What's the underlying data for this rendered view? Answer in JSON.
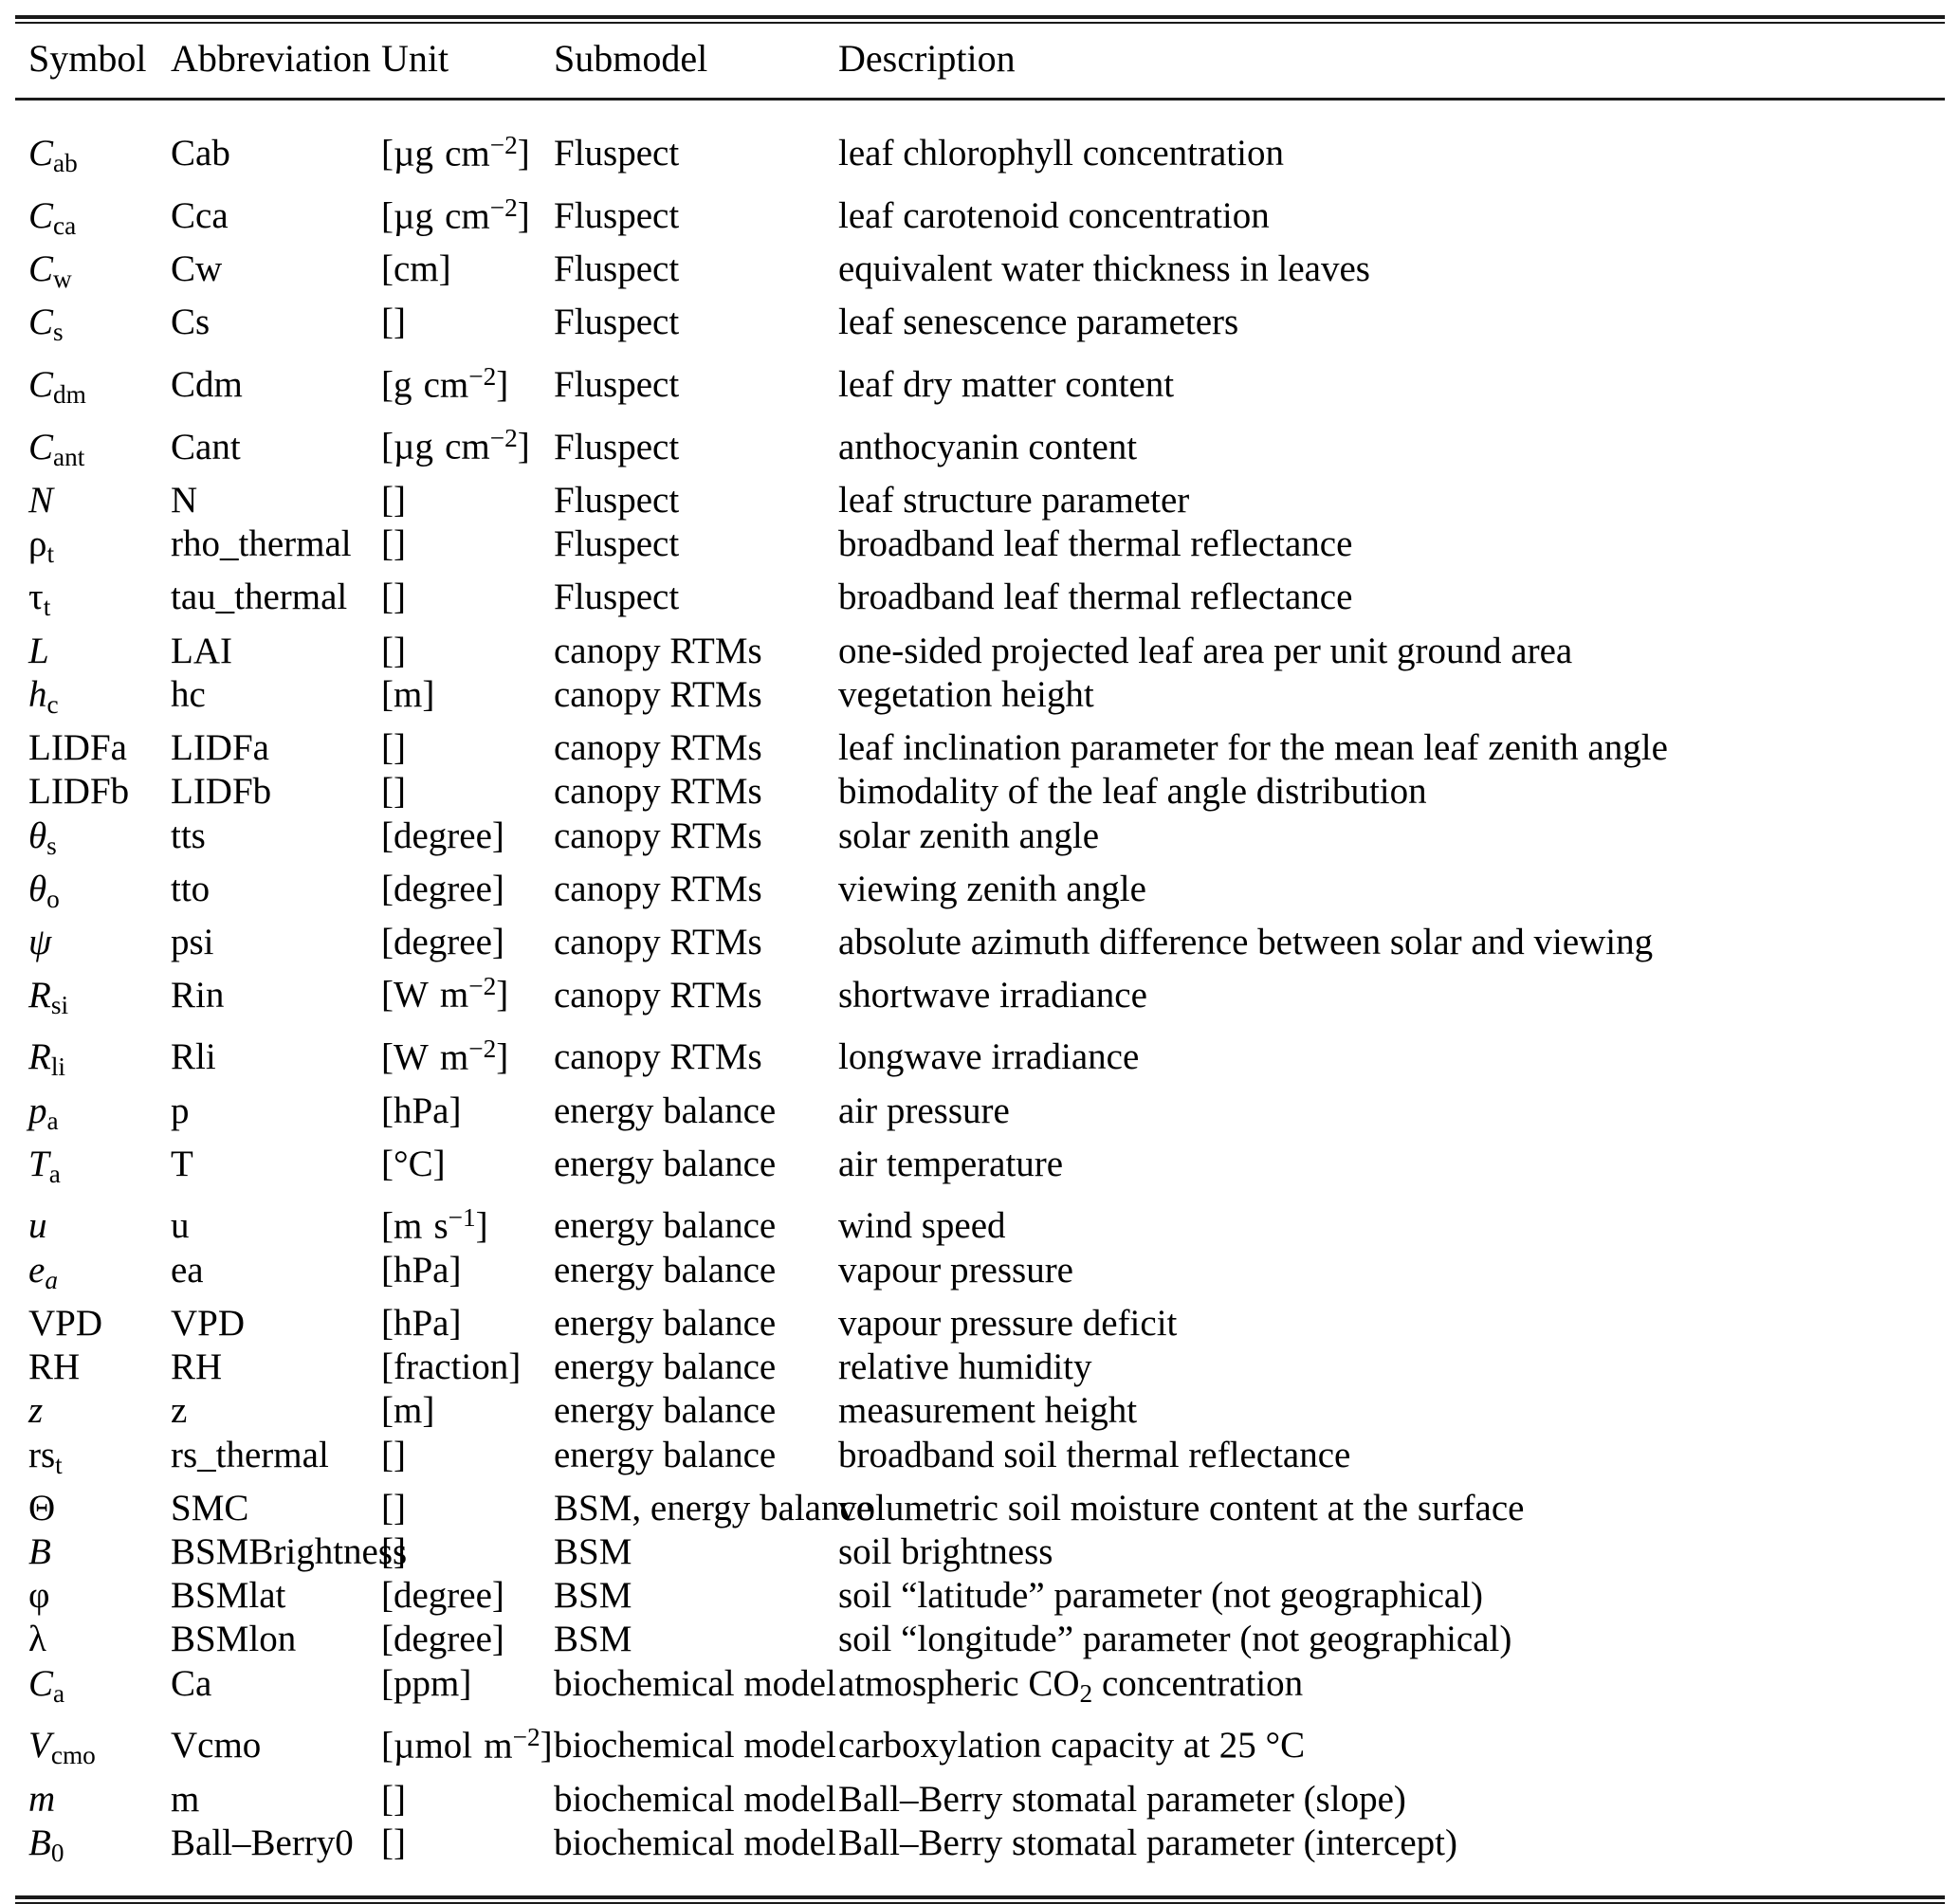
{
  "table": {
    "columns": [
      "Symbol",
      "Abbreviation",
      "Unit",
      "Submodel",
      "Description"
    ],
    "rows": [
      {
        "symbol": "C_ab",
        "symbol_text": "Cab",
        "abbreviation": "Cab",
        "unit": "[µg cm^-2]",
        "unit_text": "[µgcm−2]",
        "submodel": "Fluspect",
        "description": "leaf chlorophyll concentration"
      },
      {
        "symbol": "C_ca",
        "symbol_text": "Cca",
        "abbreviation": "Cca",
        "unit": "[µg cm^-2]",
        "unit_text": "[µgcm−2]",
        "submodel": "Fluspect",
        "description": "leaf carotenoid concentration"
      },
      {
        "symbol": "C_w",
        "symbol_text": "Cw",
        "abbreviation": "Cw",
        "unit": "[cm]",
        "unit_text": "[cm]",
        "submodel": "Fluspect",
        "description": "equivalent water thickness in leaves"
      },
      {
        "symbol": "C_s",
        "symbol_text": "Cs",
        "abbreviation": "Cs",
        "unit": "[]",
        "unit_text": "[]",
        "submodel": "Fluspect",
        "description": "leaf senescence parameters"
      },
      {
        "symbol": "C_dm",
        "symbol_text": "Cdm",
        "abbreviation": "Cdm",
        "unit": "[g cm^-2]",
        "unit_text": "[gcm−2]",
        "submodel": "Fluspect",
        "description": "leaf dry matter content"
      },
      {
        "symbol": "C_ant",
        "symbol_text": "Cant",
        "abbreviation": "Cant",
        "unit": "[µg cm^-2]",
        "unit_text": "[µgcm−2]",
        "submodel": "Fluspect",
        "description": "anthocyanin content"
      },
      {
        "symbol": "N",
        "symbol_text": "N",
        "abbreviation": "N",
        "unit": "[]",
        "unit_text": "[]",
        "submodel": "Fluspect",
        "description": "leaf structure parameter"
      },
      {
        "symbol": "rho_t",
        "symbol_text": "ρt",
        "abbreviation": "rho_thermal",
        "unit": "[]",
        "unit_text": "[]",
        "submodel": "Fluspect",
        "description": "broadband leaf thermal reflectance"
      },
      {
        "symbol": "tau_t",
        "symbol_text": "τt",
        "abbreviation": "tau_thermal",
        "unit": "[]",
        "unit_text": "[]",
        "submodel": "Fluspect",
        "description": "broadband leaf thermal reflectance"
      },
      {
        "symbol": "L",
        "symbol_text": "L",
        "abbreviation": "LAI",
        "unit": "[]",
        "unit_text": "[]",
        "submodel": "canopy RTMs",
        "description": "one-sided projected leaf area per unit ground area"
      },
      {
        "symbol": "h_c",
        "symbol_text": "hc",
        "abbreviation": "hc",
        "unit": "[m]",
        "unit_text": "[m]",
        "submodel": "canopy RTMs",
        "description": "vegetation height"
      },
      {
        "symbol": "LIDFa",
        "symbol_text": "LIDFa",
        "abbreviation": "LIDFa",
        "unit": "[]",
        "unit_text": "[]",
        "submodel": "canopy RTMs",
        "description": "leaf inclination parameter for the mean leaf zenith angle"
      },
      {
        "symbol": "LIDFb",
        "symbol_text": "LIDFb",
        "abbreviation": "LIDFb",
        "unit": "[]",
        "unit_text": "[]",
        "submodel": "canopy RTMs",
        "description": "bimodality of the leaf angle distribution"
      },
      {
        "symbol": "theta_s",
        "symbol_text": "θs",
        "abbreviation": "tts",
        "unit": "[degree]",
        "unit_text": "[degree]",
        "submodel": "canopy RTMs",
        "description": "solar zenith angle"
      },
      {
        "symbol": "theta_o",
        "symbol_text": "θo",
        "abbreviation": "tto",
        "unit": "[degree]",
        "unit_text": "[degree]",
        "submodel": "canopy RTMs",
        "description": "viewing zenith angle"
      },
      {
        "symbol": "psi",
        "symbol_text": "ψ",
        "abbreviation": "psi",
        "unit": "[degree]",
        "unit_text": "[degree]",
        "submodel": "canopy RTMs",
        "description": "absolute azimuth difference between solar and viewing"
      },
      {
        "symbol": "R_si",
        "symbol_text": "Rsi",
        "abbreviation": "Rin",
        "unit": "[W m^-2]",
        "unit_text": "[Wm−2]",
        "submodel": "canopy RTMs",
        "description": "shortwave irradiance"
      },
      {
        "symbol": "R_li",
        "symbol_text": "Rli",
        "abbreviation": "Rli",
        "unit": "[W m^-2]",
        "unit_text": "[Wm−2]",
        "submodel": "canopy RTMs",
        "description": "longwave irradiance"
      },
      {
        "symbol": "p_a",
        "symbol_text": "pa",
        "abbreviation": "p",
        "unit": "[hPa]",
        "unit_text": "[hPa]",
        "submodel": "energy balance",
        "description": "air pressure"
      },
      {
        "symbol": "T_a",
        "symbol_text": "Ta",
        "abbreviation": "T",
        "unit": "[°C]",
        "unit_text": "[°C]",
        "submodel": "energy balance",
        "description": "air temperature"
      },
      {
        "symbol": "u",
        "symbol_text": "u",
        "abbreviation": "u",
        "unit": "[m s^-1]",
        "unit_text": "[ms−1]",
        "submodel": "energy balance",
        "description": "wind speed"
      },
      {
        "symbol": "e_a",
        "symbol_text": "ea",
        "abbreviation": "ea",
        "unit": "[hPa]",
        "unit_text": "[hPa]",
        "submodel": "energy balance",
        "description": "vapour pressure"
      },
      {
        "symbol": "VPD",
        "symbol_text": "VPD",
        "abbreviation": "VPD",
        "unit": "[hPa]",
        "unit_text": "[hPa]",
        "submodel": "energy balance",
        "description": "vapour pressure deficit"
      },
      {
        "symbol": "RH",
        "symbol_text": "RH",
        "abbreviation": "RH",
        "unit": "[fraction]",
        "unit_text": "[fraction]",
        "submodel": "energy balance",
        "description": "relative humidity"
      },
      {
        "symbol": "z",
        "symbol_text": "z",
        "abbreviation": "z",
        "unit": "[m]",
        "unit_text": "[m]",
        "submodel": "energy balance",
        "description": "measurement height"
      },
      {
        "symbol": "rs_t",
        "symbol_text": "rst",
        "abbreviation": "rs_thermal",
        "unit": "[]",
        "unit_text": "[]",
        "submodel": "energy balance",
        "description": "broadband soil thermal reflectance"
      },
      {
        "symbol": "Theta",
        "symbol_text": "Θ",
        "abbreviation": "SMC",
        "unit": "[]",
        "unit_text": "[]",
        "submodel": "BSM, energy balance",
        "description": "volumetric soil moisture content at the surface"
      },
      {
        "symbol": "B",
        "symbol_text": "B",
        "abbreviation": "BSMBrightness",
        "unit": "[]",
        "unit_text": "[]",
        "submodel": "BSM",
        "description": "soil brightness"
      },
      {
        "symbol": "varphi",
        "symbol_text": "φ",
        "abbreviation": "BSMlat",
        "unit": "[degree]",
        "unit_text": "[degree]",
        "submodel": "BSM",
        "description": "soil “latitude” parameter (not geographical)"
      },
      {
        "symbol": "lambda",
        "symbol_text": "λ",
        "abbreviation": "BSMlon",
        "unit": "[degree]",
        "unit_text": "[degree]",
        "submodel": "BSM",
        "description": "soil “longitude” parameter (not geographical)"
      },
      {
        "symbol": "C_a",
        "symbol_text": "Ca",
        "abbreviation": "Ca",
        "unit": "[ppm]",
        "unit_text": "[ppm]",
        "submodel": "biochemical model",
        "description": "atmospheric CO2 concentration"
      },
      {
        "symbol": "V_cmo",
        "symbol_text": "Vcmo",
        "abbreviation": "Vcmo",
        "unit": "[µmol m^-2]",
        "unit_text": "[µmolm−2]",
        "submodel": "biochemical model",
        "description": "carboxylation capacity at 25 °C"
      },
      {
        "symbol": "m",
        "symbol_text": "m",
        "abbreviation": "m",
        "unit": "[]",
        "unit_text": "[]",
        "submodel": "biochemical model",
        "description": "Ball–Berry stomatal parameter (slope)"
      },
      {
        "symbol": "B_0",
        "symbol_text": "B0",
        "abbreviation": "Ball–Berry0",
        "unit": "[]",
        "unit_text": "[]",
        "submodel": "biochemical model",
        "description": "Ball–Berry stomatal parameter (intercept)"
      }
    ]
  }
}
